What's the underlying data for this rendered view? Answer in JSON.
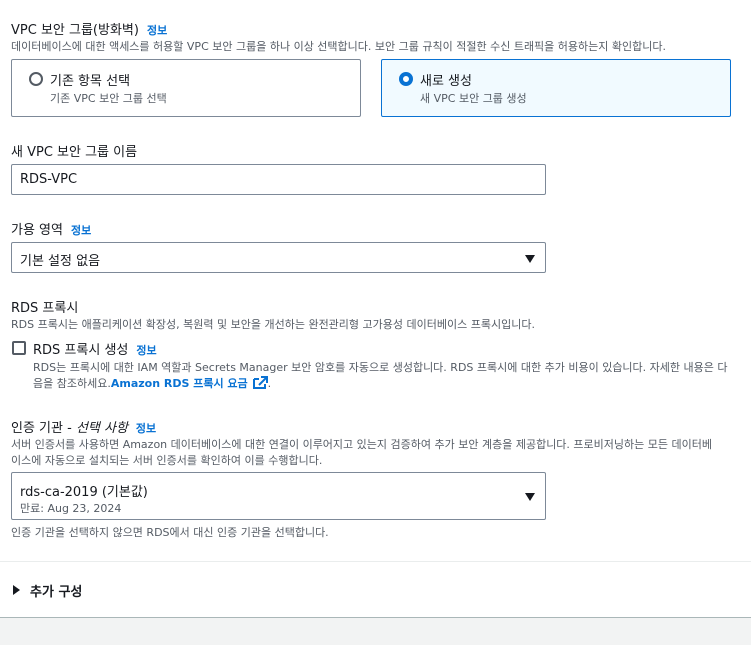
{
  "vpc_sg": {
    "label": "VPC 보안 그룹(방화벽)",
    "info": "정보",
    "description": "데이터베이스에 대한 액세스를 허용할 VPC 보안 그룹을 하나 이상 선택합니다. 보안 그룹 규칙이 적절한 수신 트래픽을 허용하는지 확인합니다.",
    "options": [
      {
        "title": "기존 항목 선택",
        "subtitle": "기존 VPC 보안 그룹 선택",
        "selected": false
      },
      {
        "title": "새로 생성",
        "subtitle": "새 VPC 보안 그룹 생성",
        "selected": true
      }
    ]
  },
  "new_sg_name": {
    "label": "새 VPC 보안 그룹 이름",
    "value": "RDS-VPC"
  },
  "az": {
    "label": "가용 영역",
    "info": "정보",
    "value": "기본 설정 없음"
  },
  "proxy": {
    "label": "RDS 프록시",
    "description": "RDS 프록시는 애플리케이션 확장성, 복원력 및 보안을 개선하는 완전관리형 고가용성 데이터베이스 프록시입니다.",
    "checkbox_label": "RDS 프록시 생성",
    "info": "정보",
    "checkbox_desc_line1": "RDS는 프록시에 대한 IAM 역할과 Secrets Manager 보안 암호를 자동으로 생성합니다. RDS 프록시에 대한 추가 비용이 있습니다. 자세한 내용은 다",
    "checkbox_desc_line2_prefix": "음을 참조하세요.",
    "pricing_link": "Amazon RDS 프록시 요금",
    "period": "."
  },
  "ca": {
    "label_prefix": "인증 기관 - ",
    "label_optional": "선택 사항",
    "info": "정보",
    "description_line1": "서버 인증서를 사용하면 Amazon 데이터베이스에 대한 연결이 이루어지고 있는지 검증하여 추가 보안 계층을 제공합니다. 프로비저닝하는 모든 데이터베",
    "description_line2": "이스에 자동으로 설치되는 서버 인증서를 확인하여 이를 수행합니다.",
    "value": "rds-ca-2019 (기본값)",
    "expiry": "만료: Aug 23, 2024",
    "footer": "인증 기관을 선택하지 않으면 RDS에서 대신 인증 기관을 선택합니다."
  },
  "additional": {
    "label": "추가 구성"
  }
}
